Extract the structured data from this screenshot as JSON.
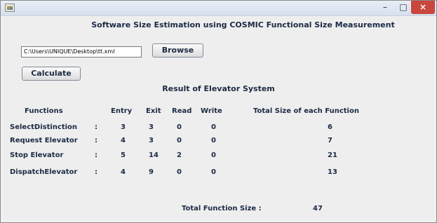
{
  "window": {
    "app_icon": "java-app-icon",
    "controls": {
      "minimize": "–",
      "maximize": "□",
      "close": "×"
    }
  },
  "header": {
    "title": "Software Size Estimation using COSMIC Functional Size Measurement"
  },
  "file": {
    "path_value": "C:\\Users\\UNIQUE\\Desktop\\tt.xml",
    "browse_label": "Browse"
  },
  "actions": {
    "calculate_label": "Calculate"
  },
  "result": {
    "title": "Result of Elevator System",
    "columns": {
      "functions": "Functions",
      "entry": "Entry",
      "exit": "Exit",
      "read": "Read",
      "write": "Write",
      "total": "Total Size of each Function"
    },
    "rows": [
      {
        "name": "SelectDistinction",
        "colon": ":",
        "entry": "3",
        "exit": "3",
        "read": "0",
        "write": "0",
        "total": "6"
      },
      {
        "name": "Request Elevator",
        "colon": ":",
        "entry": "4",
        "exit": "3",
        "read": "0",
        "write": "0",
        "total": "7"
      },
      {
        "name": "Stop Elevator",
        "colon": ":",
        "entry": "5",
        "exit": "14",
        "read": "2",
        "write": "0",
        "total": "21"
      },
      {
        "name": "DispatchElevator",
        "colon": ":",
        "entry": "4",
        "exit": "9",
        "read": "0",
        "write": "0",
        "total": "13"
      }
    ],
    "total_label": "Total Function Size :",
    "total_value": "47"
  }
}
